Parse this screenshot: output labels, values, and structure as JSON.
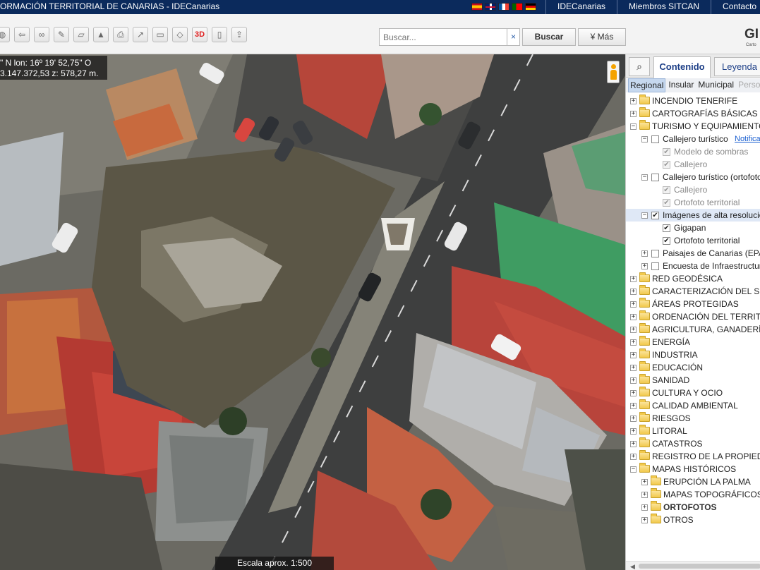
{
  "header": {
    "title": "ORMACIÓN TERRITORIAL DE CANARIAS - IDECanarias",
    "links": [
      "IDECanarias",
      "Miembros SITCAN",
      "Contacto"
    ]
  },
  "search": {
    "placeholder": "Buscar...",
    "clear_label": "×",
    "button_label": "Buscar",
    "more_label": "¥ Más"
  },
  "logo": {
    "text": "GI",
    "subtext": "Carto"
  },
  "tools": [
    {
      "icon": "globe-icon",
      "glyph": "◍"
    },
    {
      "icon": "back-icon",
      "glyph": "⇦"
    },
    {
      "icon": "link-icon",
      "glyph": "∞"
    },
    {
      "icon": "pencil-icon",
      "glyph": "✎"
    },
    {
      "icon": "ruler-icon",
      "glyph": "▱"
    },
    {
      "icon": "profile-icon",
      "glyph": "▲"
    },
    {
      "icon": "print-icon",
      "glyph": "⎙"
    },
    {
      "icon": "route-icon",
      "glyph": "↗"
    },
    {
      "icon": "dimension-icon",
      "glyph": "▭"
    },
    {
      "icon": "layers-icon",
      "glyph": "◇"
    },
    {
      "icon": "3d-icon",
      "glyph": "3D"
    },
    {
      "icon": "book-icon",
      "glyph": "▯"
    },
    {
      "icon": "share-icon",
      "glyph": "⇪"
    }
  ],
  "map": {
    "coords_line1": "\" N  lon: 16º 19' 52,75\" O",
    "coords_line2": "3.147.372,53  z: 578,27 m.",
    "scale": "Escala aprox. 1:500"
  },
  "panel": {
    "tab_search_icon": "⌕",
    "tabs": [
      "Contenido",
      "Leyenda"
    ],
    "subtabs": [
      "Regional",
      "Insular",
      "Municipal",
      "Perso"
    ],
    "tree": [
      {
        "level": 0,
        "exp": "+",
        "type": "folder",
        "label": "INCENDIO TENERIFE"
      },
      {
        "level": 0,
        "exp": "+",
        "type": "folder",
        "label": "CARTOGRAFÍAS BÁSICAS"
      },
      {
        "level": 0,
        "exp": "−",
        "type": "folder",
        "label": "TURISMO Y EQUIPAMIENTOS"
      },
      {
        "level": 1,
        "exp": "−",
        "type": "check",
        "checked": false,
        "label": "Callejero turístico",
        "link": "Notifica"
      },
      {
        "level": 2,
        "exp": "",
        "type": "check",
        "checked": true,
        "disabled": true,
        "label": "Modelo de sombras"
      },
      {
        "level": 2,
        "exp": "",
        "type": "check",
        "checked": true,
        "disabled": true,
        "label": "Callejero"
      },
      {
        "level": 1,
        "exp": "−",
        "type": "check",
        "checked": false,
        "label": "Callejero turístico (ortofoto"
      },
      {
        "level": 2,
        "exp": "",
        "type": "check",
        "checked": true,
        "disabled": true,
        "label": "Callejero"
      },
      {
        "level": 2,
        "exp": "",
        "type": "check",
        "checked": true,
        "disabled": true,
        "label": "Ortofoto territorial"
      },
      {
        "level": 1,
        "exp": "−",
        "type": "check",
        "checked": true,
        "selected": true,
        "label": "Imágenes de alta resolució"
      },
      {
        "level": 2,
        "exp": "",
        "type": "check",
        "checked": true,
        "label": "Gigapan"
      },
      {
        "level": 2,
        "exp": "",
        "type": "check",
        "checked": true,
        "label": "Ortofoto territorial"
      },
      {
        "level": 1,
        "exp": "+",
        "type": "check",
        "checked": false,
        "label": "Paisajes de Canarias (EPAN"
      },
      {
        "level": 1,
        "exp": "+",
        "type": "check",
        "checked": false,
        "label": "Encuesta de Infraestructur"
      },
      {
        "level": 0,
        "exp": "+",
        "type": "folder",
        "label": "RED GEODÉSICA"
      },
      {
        "level": 0,
        "exp": "+",
        "type": "folder",
        "label": "CARACTERIZACIÓN DEL SUEL"
      },
      {
        "level": 0,
        "exp": "+",
        "type": "folder",
        "label": "ÁREAS PROTEGIDAS"
      },
      {
        "level": 0,
        "exp": "+",
        "type": "folder",
        "label": "ORDENACIÓN DEL TERRITORI"
      },
      {
        "level": 0,
        "exp": "+",
        "type": "folder",
        "label": "AGRICULTURA, GANADERÍA y"
      },
      {
        "level": 0,
        "exp": "+",
        "type": "folder",
        "label": "ENERGÍA"
      },
      {
        "level": 0,
        "exp": "+",
        "type": "folder",
        "label": "INDUSTRIA"
      },
      {
        "level": 0,
        "exp": "+",
        "type": "folder",
        "label": "EDUCACIÓN"
      },
      {
        "level": 0,
        "exp": "+",
        "type": "folder",
        "label": "SANIDAD"
      },
      {
        "level": 0,
        "exp": "+",
        "type": "folder",
        "label": "CULTURA Y OCIO"
      },
      {
        "level": 0,
        "exp": "+",
        "type": "folder",
        "label": "CALIDAD AMBIENTAL"
      },
      {
        "level": 0,
        "exp": "+",
        "type": "folder",
        "label": "RIESGOS"
      },
      {
        "level": 0,
        "exp": "+",
        "type": "folder",
        "label": "LITORAL"
      },
      {
        "level": 0,
        "exp": "+",
        "type": "folder",
        "label": "CATASTROS"
      },
      {
        "level": 0,
        "exp": "+",
        "type": "folder",
        "label": "REGISTRO DE LA PROPIEDAD"
      },
      {
        "level": 0,
        "exp": "−",
        "type": "folder",
        "label": "MAPAS HISTÓRICOS"
      },
      {
        "level": 1,
        "exp": "+",
        "type": "folder",
        "label": "ERUPCIÓN LA PALMA"
      },
      {
        "level": 1,
        "exp": "+",
        "type": "folder",
        "label": "MAPAS TOPOGRÁFICOS"
      },
      {
        "level": 1,
        "exp": "+",
        "type": "folder",
        "bold": true,
        "label": "ORTOFOTOS"
      },
      {
        "level": 1,
        "exp": "+",
        "type": "folder",
        "label": "OTROS"
      }
    ]
  }
}
